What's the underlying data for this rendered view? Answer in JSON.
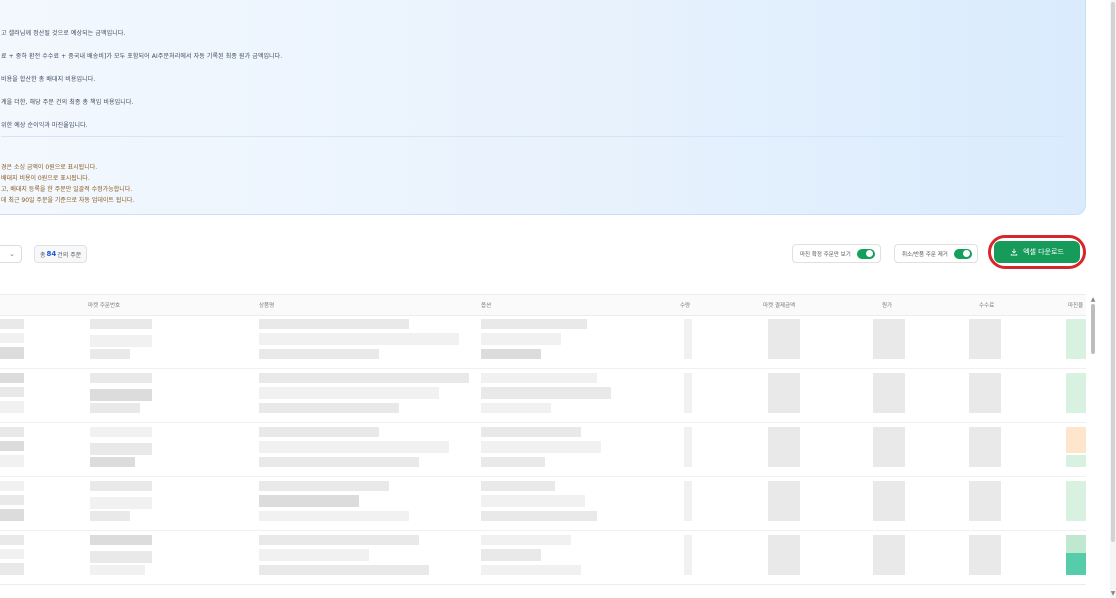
{
  "info": {
    "lines": [
      "고 셀러님께 정산될 것으로 예상되는 금액입니다.",
      "료 + 중하 환전 수수료 + 중국내 배송비]가 모두 포함되어 AI주문처리에서 자동 기록된 최종 원가 금액입니다.",
      "비용을 합산한 총 배대지 비용입니다.",
      "계을 더한, 해당 주문 건의 최종 총 책임 비용입니다.",
      "위한 예상 순이익과 마진율입니다."
    ],
    "notes": [
      "경은 소싱 금액이 0원으로 표시됩니다.",
      "배대지 비용이 0원으로 표시됩니다.",
      "고, 배대지 등록을 한 주문만 일괄적 수정가능합니다.",
      "데 최근 90일 주문을 기준으로 자동 업데이트 됩니다."
    ]
  },
  "toolbar": {
    "select_chevron": "⌄",
    "count_prefix": "총",
    "count_value": "84",
    "count_suffix": "건의 주문",
    "toggle_1_label": "마진 확정 주문만 보기",
    "toggle_2_label": "취소/반품 주문 제거",
    "excel_label": "엑셀 다운로드"
  },
  "table": {
    "headers": [
      "마켓 주문번호",
      "상품명",
      "옵션",
      "수량",
      "마켓 결제금액",
      "원가",
      "수수료",
      "예상마진",
      "마진율"
    ]
  },
  "scroll": {
    "up": "▲",
    "down": "▼"
  }
}
